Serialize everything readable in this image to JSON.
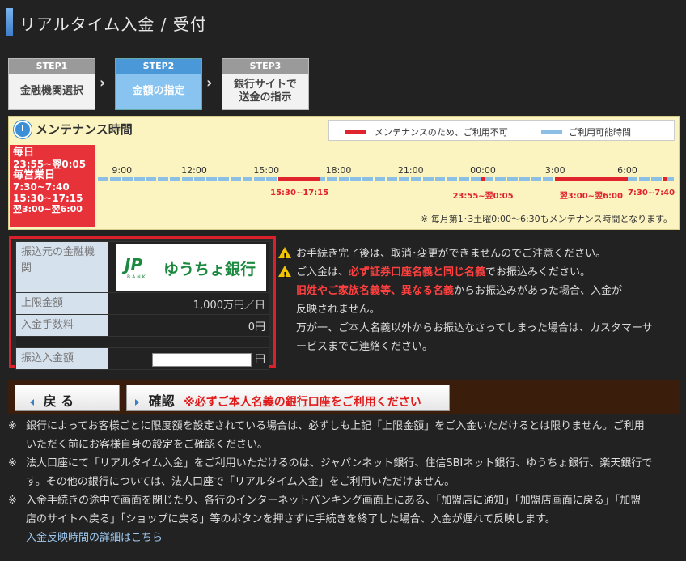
{
  "page": {
    "title": "リアルタイム入金 / 受付"
  },
  "steps": [
    {
      "head": "STEP1",
      "label": "金融機関選択",
      "active": false
    },
    {
      "head": "STEP2",
      "label": "金額の指定",
      "active": true
    },
    {
      "head": "STEP3",
      "label_line1": "銀行サイトで",
      "label_line2": "送金の指示",
      "active": false
    }
  ],
  "maintenance": {
    "title": "メンテナンス時間",
    "legend_unavailable": "メンテナンスのため、ご利用不可",
    "legend_available": "ご利用可能時間",
    "colors": {
      "unavailable": "#e0242b",
      "available": "#8cbfe6"
    },
    "daily_label": "毎日",
    "daily_time": "23:55~翌0:05",
    "business_label": "毎営業日",
    "business_times": [
      "7:30~7:40",
      "15:30~17:15",
      "翌3:00~翌6:00"
    ],
    "hours": [
      "9:00",
      "12:00",
      "15:00",
      "18:00",
      "21:00",
      "00:00",
      "3:00",
      "6:00"
    ],
    "red_labels": [
      "15:30~17:15",
      "23:55~翌0:05",
      "翌3:00~翌6:00",
      "7:30~7:40"
    ],
    "note": "※ 毎月第1･3土曜0:00～6:30もメンテナンス時間となります。"
  },
  "bank": {
    "source_label": "振込元の金融機関",
    "bank_name": "ゆうちょ銀行",
    "logo_mark": "JP",
    "logo_sub": "BANK",
    "limit_label": "上限金額",
    "limit_value": "1,000万円／日",
    "fee_label": "入金手数料",
    "fee_value": "0円",
    "amount_label": "振込入金額",
    "amount_value": "",
    "amount_unit": "円"
  },
  "notices": {
    "line1": "お手続き完了後は、取消･変更ができませんのでご注意ください。",
    "line2_pre": "ご入金は、",
    "line2_red": "必ず証券口座名義と同じ名義",
    "line2_post": "でお振込みください。",
    "line3_red": "旧姓やご家族名義等、異なる名義",
    "line3_post": "からお振込みがあった場合、入金が",
    "line4": "反映されません。",
    "line5": "万が一、ご本人名義以外からお振込なさってしまった場合は、カスタマーサ",
    "line6": "ービスまでご連絡ください。"
  },
  "actions": {
    "back_label": "戻 る",
    "confirm_label": "確認",
    "confirm_note": "※必ずご本人名義の銀行口座をご利用ください"
  },
  "footnotes": {
    "mark": "※",
    "f1a": "銀行によってお客様ごとに限度額を設定されている場合は、必ずしも上記「上限金額」をご入金いただけるとは限りません。ご利用",
    "f1b": "いただく前にお客様自身の設定をご確認ください。",
    "f2a": "法人口座にて「リアルタイム入金」をご利用いただけるのは、ジャパンネット銀行、住信SBIネット銀行、ゆうちょ銀行、楽天銀行で",
    "f2b": "す。その他の銀行については、法人口座で「リアルタイム入金」をご利用いただけません。",
    "f3a": "入金手続きの途中で画面を閉じたり、各行のインターネットバンキング画面上にある、「加盟店に通知」「加盟店画面に戻る」「加盟",
    "f3b": "店のサイトへ戻る」「ショップに戻る」等のボタンを押さずに手続きを終了した場合、入金が遅れて反映します。",
    "link": "入金反映時間の詳細はこちら"
  }
}
